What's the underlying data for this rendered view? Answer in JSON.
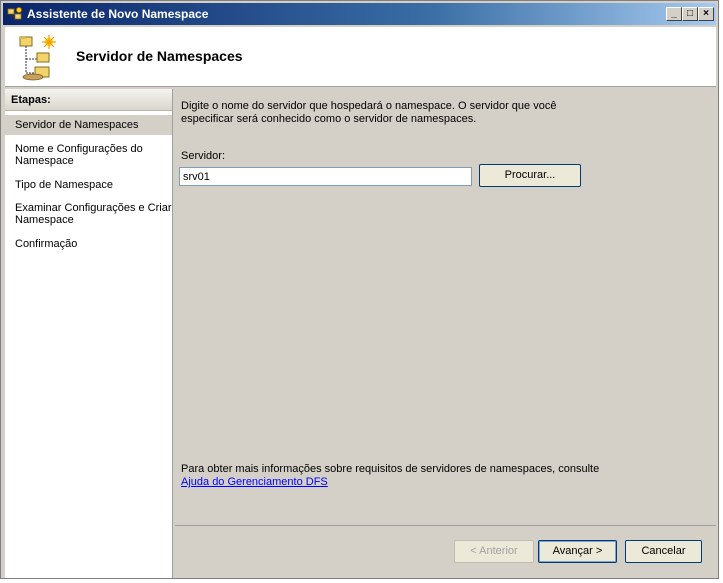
{
  "window": {
    "title": "Assistente de Novo Namespace",
    "title_buttons": [
      "_",
      "□",
      "×"
    ]
  },
  "header": {
    "title": "Servidor de Namespaces",
    "icon": "namespace-wizard-icon"
  },
  "steps": {
    "heading": "Etapas:",
    "items": [
      {
        "label": "Servidor de Namespaces",
        "active": true
      },
      {
        "label": "Nome e Configurações do Namespace",
        "active": false
      },
      {
        "label": "Tipo de Namespace",
        "active": false
      },
      {
        "label": "Examinar Configurações e Criar Namespace",
        "active": false
      },
      {
        "label": "Confirmação",
        "active": false
      }
    ]
  },
  "main": {
    "description": "Digite o nome do servidor que hospedará o namespace. O servidor que você especificar será conhecido como o servidor de namespaces.",
    "server_label": "Servidor:",
    "server_value": "srv01",
    "browse_label": "Procurar...",
    "info_text": "Para obter mais informações sobre requisitos de servidores de namespaces, consulte",
    "info_link": "Ajuda do Gerenciamento DFS"
  },
  "footer": {
    "back_label": "< Anterior",
    "next_label": "Avançar >",
    "cancel_label": "Cancelar"
  }
}
